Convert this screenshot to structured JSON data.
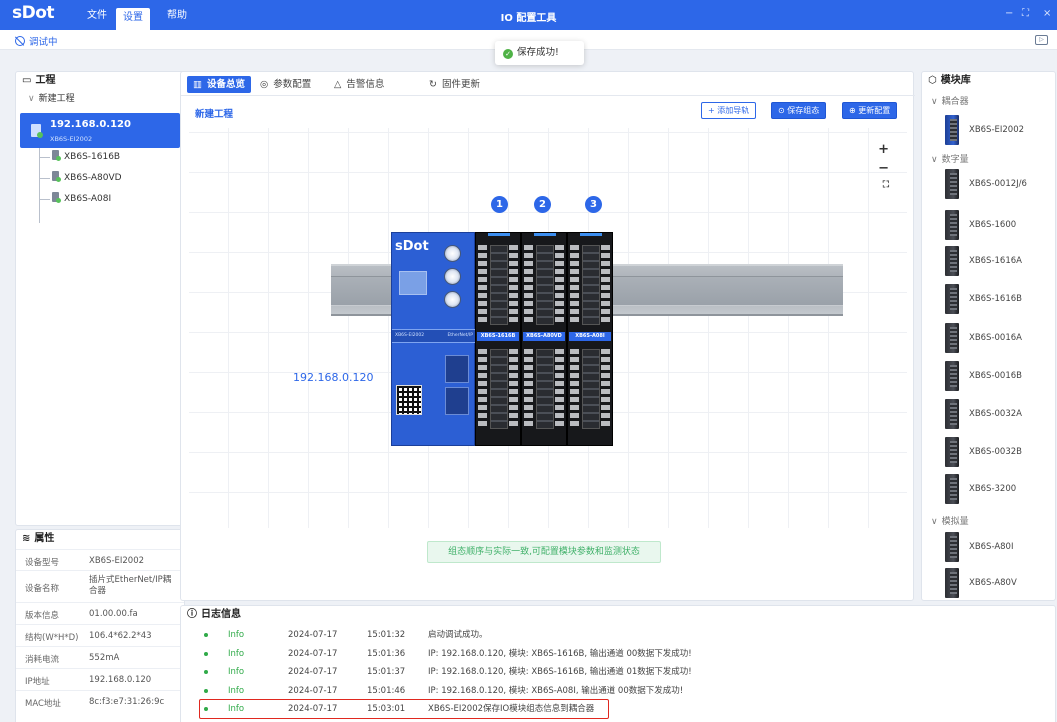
{
  "app": {
    "logo": "sDot",
    "title": "IO 配置工具",
    "menu": [
      "文件",
      "设置",
      "帮助"
    ],
    "window_controls": [
      "−",
      "⛶",
      "×"
    ]
  },
  "subbar": {
    "debug_status": "调试中",
    "collapse_icon": "panel-collapse-icon"
  },
  "toast": {
    "text": "保存成功!",
    "color": "#4fb246"
  },
  "project": {
    "heading": "工程",
    "root": "新建工程",
    "selected_ip": "192.168.0.120",
    "selected_model": "XB6S-EI2002",
    "children": [
      "XB6S-1616B",
      "XB6S-A80VD",
      "XB6S-A08I"
    ]
  },
  "properties": {
    "heading": "属性",
    "rows": [
      {
        "k": "设备型号",
        "v": "XB6S-EI2002"
      },
      {
        "k": "设备名称",
        "v": "插片式EtherNet/IP耦合器"
      },
      {
        "k": "版本信息",
        "v": "01.00.00.fa"
      },
      {
        "k": "结构(W*H*D)",
        "v": "106.4*62.2*43"
      },
      {
        "k": "消耗电流",
        "v": "552mA"
      },
      {
        "k": "IP地址",
        "v": "192.168.0.120"
      },
      {
        "k": "MAC地址",
        "v": "8c:f3:e7:31:26:9c"
      }
    ]
  },
  "tabs": [
    {
      "label": "设备总览",
      "icon": "▥",
      "active": true
    },
    {
      "label": "参数配置",
      "icon": "◎",
      "active": false
    },
    {
      "label": "告警信息",
      "icon": "△",
      "active": false
    },
    {
      "label": "固件更新",
      "icon": "↻",
      "active": false
    }
  ],
  "canvas": {
    "title": "新建工程",
    "btn_add_rail": "+ 添加导轨",
    "btn_save_config": "⊙ 保存组态",
    "btn_update_config": "⊕ 更新配置",
    "zoom": [
      "+",
      "−",
      "⛶"
    ],
    "ip_label": "192.168.0.120",
    "badges": [
      "1",
      "2",
      "3"
    ],
    "coupler": {
      "brand": "sDot",
      "model": "XB6S-EI2002",
      "bus": "EtherNet/IP"
    },
    "modules": [
      "XB6S-1616B",
      "XB6S-A80VD",
      "XB6S-A08I"
    ],
    "hint": "组态顺序与实际一致,可配置模块参数和监测状态",
    "accent": "#2d67e8"
  },
  "log": {
    "heading": "日志信息",
    "rows": [
      {
        "level": "Info",
        "date": "2024-07-17",
        "time": "15:01:32",
        "msg": "启动调试成功。"
      },
      {
        "level": "Info",
        "date": "2024-07-17",
        "time": "15:01:36",
        "msg": "IP: 192.168.0.120, 模块: XB6S-1616B, 输出通道 00数据下发成功!"
      },
      {
        "level": "Info",
        "date": "2024-07-17",
        "time": "15:01:37",
        "msg": "IP: 192.168.0.120, 模块: XB6S-1616B, 输出通道 01数据下发成功!"
      },
      {
        "level": "Info",
        "date": "2024-07-17",
        "time": "15:01:46",
        "msg": "IP: 192.168.0.120, 模块: XB6S-A08I, 输出通道 00数据下发成功!"
      },
      {
        "level": "Info",
        "date": "2024-07-17",
        "time": "15:03:01",
        "msg": "XB6S-EI2002保存IO模块组态信息到耦合器"
      }
    ],
    "highlight_color": "#e0281f"
  },
  "library": {
    "heading": "模块库",
    "groups": [
      {
        "label": "耦合器",
        "items": [
          "XB6S-EI2002"
        ]
      },
      {
        "label": "数字量",
        "items": [
          "XB6S-0012J/6",
          "XB6S-1600",
          "XB6S-1616A",
          "XB6S-1616B",
          "XB6S-0016A",
          "XB6S-0016B",
          "XB6S-0032A",
          "XB6S-0032B",
          "XB6S-3200"
        ]
      },
      {
        "label": "模拟量",
        "items": [
          "XB6S-A80I",
          "XB6S-A80V"
        ]
      }
    ]
  }
}
